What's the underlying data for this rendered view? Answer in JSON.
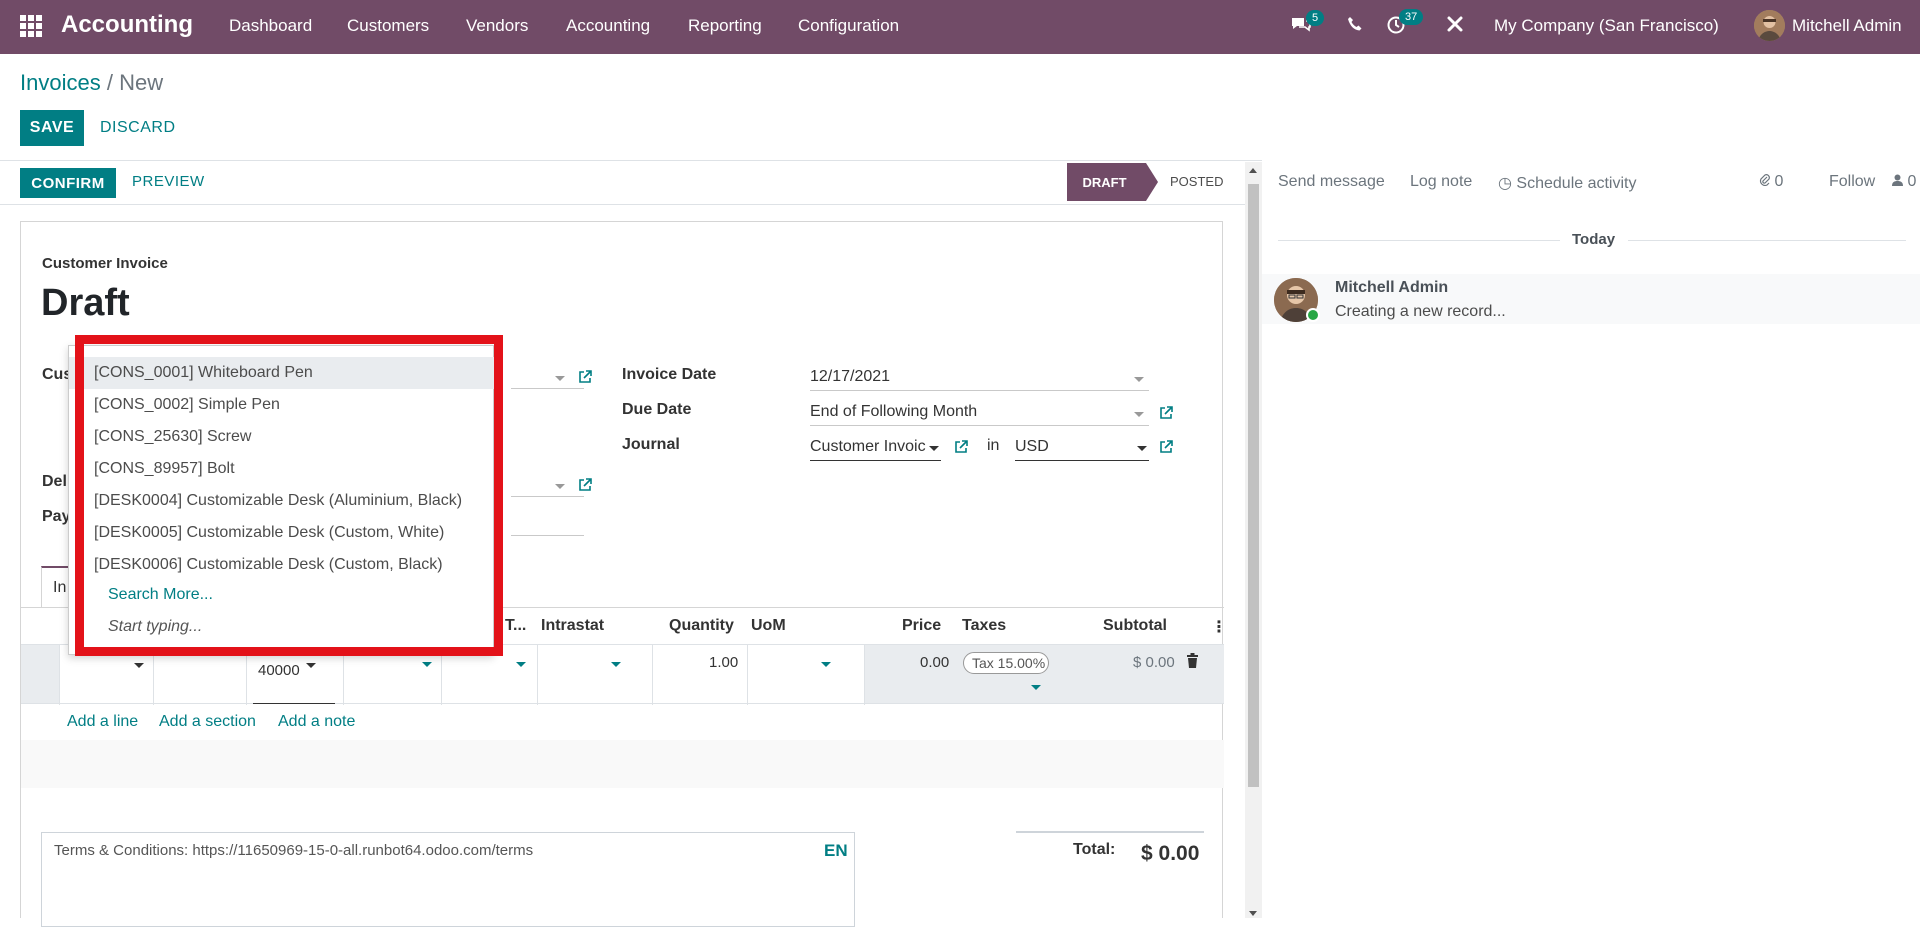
{
  "topbar": {
    "app_name": "Accounting",
    "menu": [
      "Dashboard",
      "Customers",
      "Vendors",
      "Accounting",
      "Reporting",
      "Configuration"
    ],
    "messages_badge": "5",
    "activities_badge": "37",
    "company": "My Company (San Francisco)",
    "user": "Mitchell Admin"
  },
  "breadcrumb": {
    "parent": "Invoices",
    "sep": "/",
    "current": "New"
  },
  "actions": {
    "save": "SAVE",
    "discard": "DISCARD"
  },
  "statusbar": {
    "confirm": "CONFIRM",
    "preview": "PREVIEW",
    "stages": [
      "DRAFT",
      "POSTED"
    ],
    "active_stage": "DRAFT"
  },
  "form": {
    "type_label": "Customer Invoice",
    "title": "Draft",
    "left_labels": [
      "Cus",
      "Deli",
      "Pay"
    ],
    "invoice_date_label": "Invoice Date",
    "invoice_date": "12/17/2021",
    "due_date_label": "Due Date",
    "due_date": "End of Following Month",
    "journal_label": "Journal",
    "journal": "Customer Invoic",
    "in_label": "in",
    "currency": "USD",
    "tab_partial": "In"
  },
  "table": {
    "headers": [
      "T...",
      "Intrastat",
      "Quantity",
      "UoM",
      "Price",
      "Taxes",
      "Subtotal"
    ],
    "row": {
      "account": "40000",
      "quantity": "1.00",
      "price": "0.00",
      "tax": "Tax 15.00%",
      "subtotal": "$ 0.00"
    },
    "add_line": "Add a line",
    "add_section": "Add a section",
    "add_note": "Add a note"
  },
  "dropdown": {
    "options": [
      "[CONS_0001] Whiteboard Pen",
      "[CONS_0002] Simple Pen",
      "[CONS_25630] Screw",
      "[CONS_89957] Bolt",
      "[DESK0004] Customizable Desk (Aluminium, Black)",
      "[DESK0005] Customizable Desk (Custom, White)",
      "[DESK0006] Customizable Desk (Custom, Black)"
    ],
    "search_more": "Search More...",
    "start_typing": "Start typing..."
  },
  "footer": {
    "terms": "Terms & Conditions: https://11650969-15-0-all.runbot64.odoo.com/terms",
    "lang": "EN",
    "total_label": "Total:",
    "total_value": "$ 0.00"
  },
  "chatter": {
    "send_message": "Send message",
    "log_note": "Log note",
    "schedule_activity": "Schedule activity",
    "attachments": "0",
    "follow": "Follow",
    "followers": "0",
    "today": "Today",
    "author": "Mitchell Admin",
    "body": "Creating a new record..."
  },
  "colors": {
    "brand": "#714b67",
    "accent": "#017e84",
    "highlight": "#e31219"
  }
}
